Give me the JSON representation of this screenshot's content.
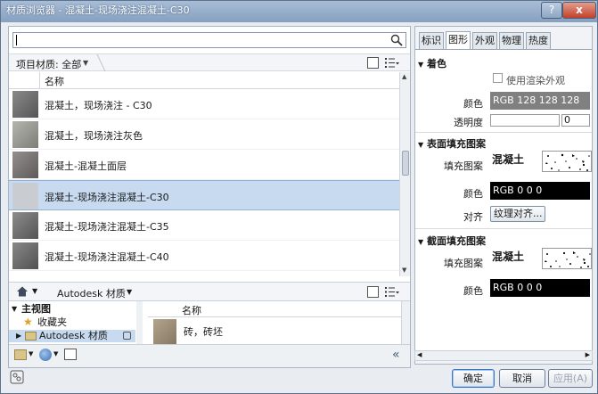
{
  "window": {
    "title": "材质浏览器 - 混凝土-现场浇注混凝土-C30",
    "help": "?",
    "close": "x"
  },
  "search": {
    "placeholder": ""
  },
  "project": {
    "breadcrumb": "项目材质: 全部",
    "column_name": "名称",
    "materials": [
      {
        "name": "混凝土，现场浇注 - C30",
        "selected": false,
        "tone": "#6c6c6c"
      },
      {
        "name": "混凝土，现场浇注灰色",
        "selected": false,
        "tone": "#9a9a96"
      },
      {
        "name": "混凝土-混凝土面层",
        "selected": false,
        "tone": "#7a7676"
      },
      {
        "name": "混凝土-现场浇注混凝土-C30",
        "selected": true,
        "tone": "#c8cbd0"
      },
      {
        "name": "混凝土-现场浇注混凝土-C35",
        "selected": false,
        "tone": "#6e6e6e"
      },
      {
        "name": "混凝土-现场浇注混凝土-C40",
        "selected": false,
        "tone": "#6a6a6a"
      }
    ]
  },
  "library": {
    "breadcrumb": "Autodesk 材质",
    "tree": [
      {
        "label": "主视图",
        "expanded": true,
        "bold": true
      },
      {
        "label": "收藏夹",
        "icon": "star"
      },
      {
        "label": "Autodesk 材质",
        "selected": true,
        "locked": true
      }
    ],
    "column_name": "名称",
    "items": [
      {
        "name": "砖，砖坯"
      }
    ]
  },
  "tabs": [
    {
      "label": "标识",
      "active": false
    },
    {
      "label": "图形",
      "active": true
    },
    {
      "label": "外观",
      "active": false
    },
    {
      "label": "物理",
      "active": false
    },
    {
      "label": "热度",
      "active": false
    }
  ],
  "graphics": {
    "shading": {
      "title": "着色",
      "use_render_label": "使用渲染外观",
      "color_label": "颜色",
      "color_value": "RGB 128 128 128",
      "transparency_label": "透明度",
      "transparency_value": "0"
    },
    "surface_pattern": {
      "title": "表面填充图案",
      "fill_label": "填充图案",
      "fill_name": "混凝土",
      "color_label": "颜色",
      "color_value": "RGB 0 0 0",
      "align_label": "对齐",
      "align_button": "纹理对齐..."
    },
    "cut_pattern": {
      "title": "截面填充图案",
      "fill_label": "填充图案",
      "fill_name": "混凝土",
      "color_label": "颜色",
      "color_value": "RGB 0 0 0"
    }
  },
  "buttons": {
    "ok": "确定",
    "cancel": "取消",
    "apply": "应用(A)"
  },
  "colors": {
    "selection": "#c7daf0",
    "accent": "#3b79c7"
  }
}
